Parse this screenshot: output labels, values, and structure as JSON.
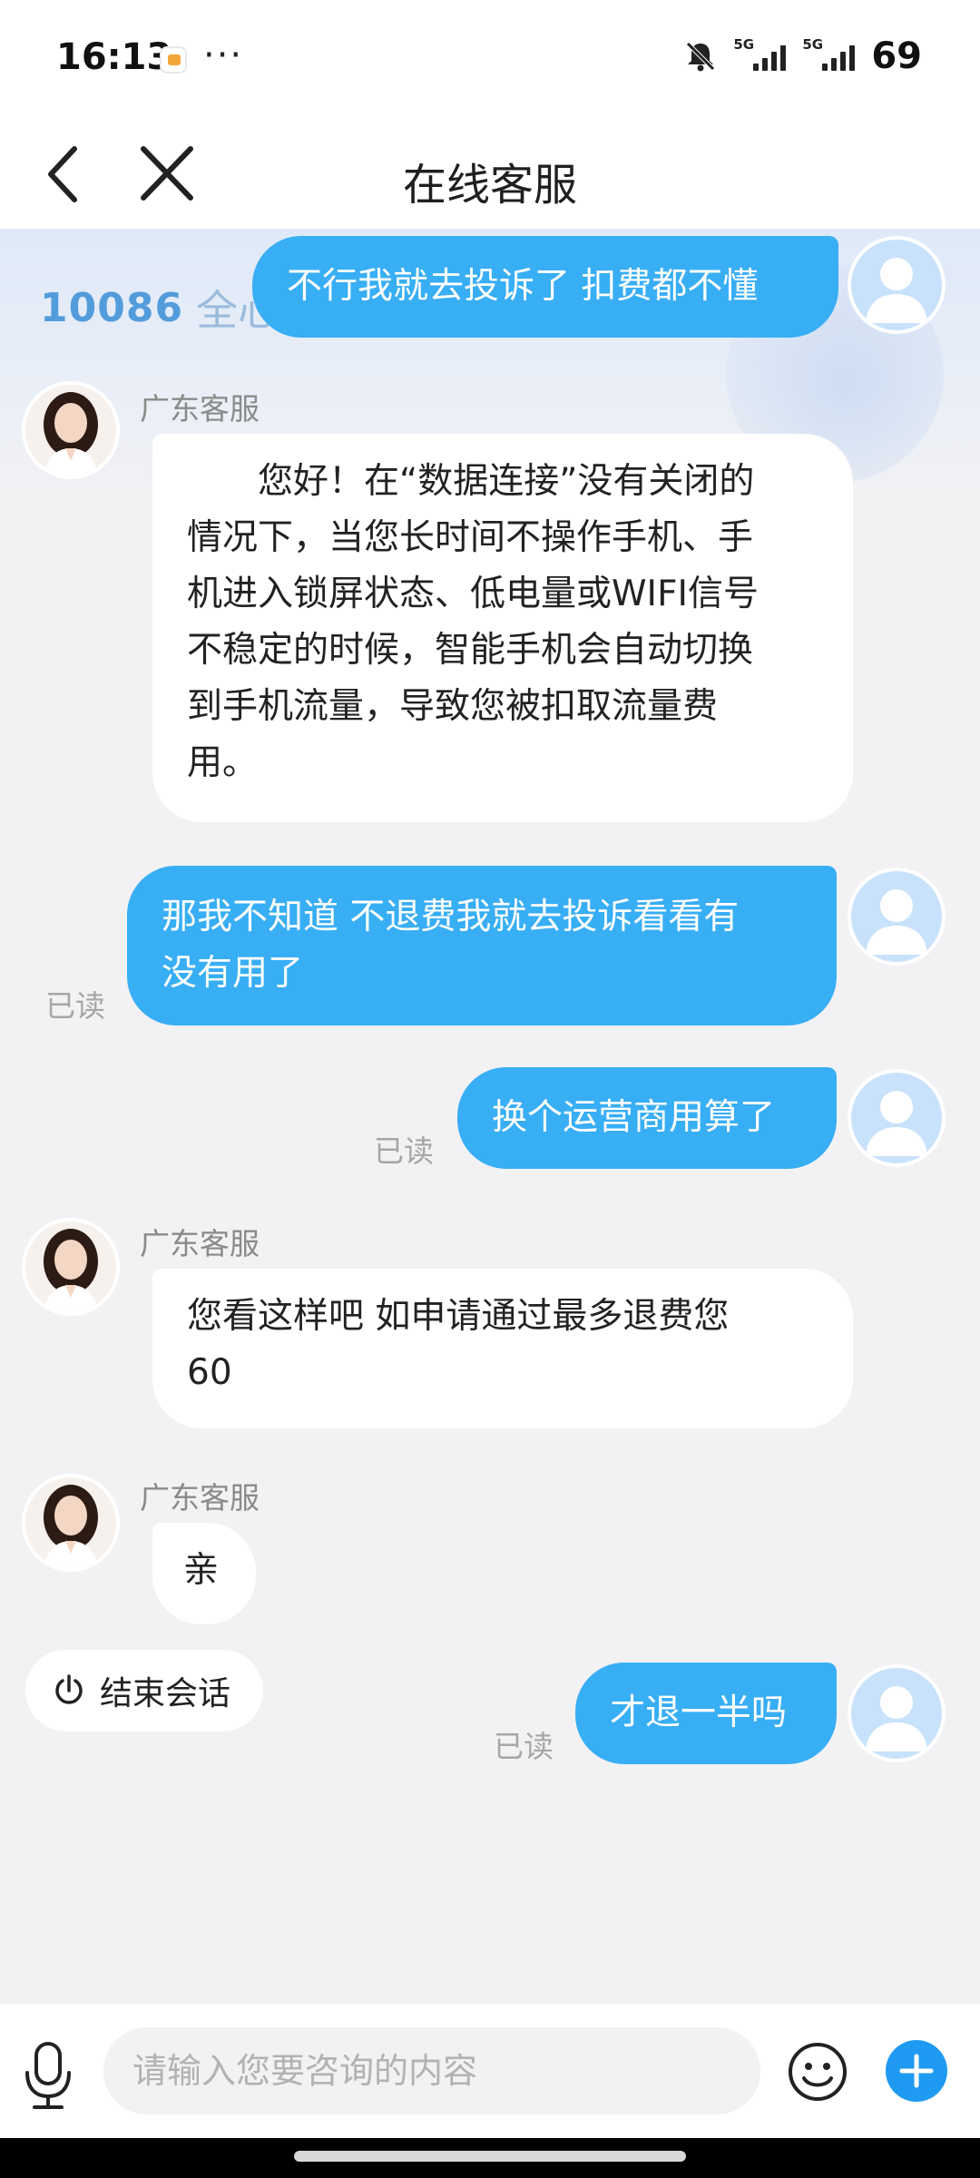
{
  "status_bar": {
    "time": "16:13",
    "more": "···",
    "network_1": "5G",
    "network_2": "5G",
    "battery": "69"
  },
  "header": {
    "title": "在线客服"
  },
  "brand": {
    "number": "10086",
    "text": "全心全"
  },
  "messages": [
    {
      "role": "user",
      "text": "不行我就去投诉了 扣费都不懂"
    },
    {
      "role": "agent",
      "name": "广东客服",
      "lines": [
        "　　您好！在“数据连接”没有关闭的",
        "情况下，当您长时间不操作手机、手",
        "机进入锁屏状态、低电量或WIFI信号",
        "不稳定的时候，智能手机会自动切换",
        "到手机流量，导致您被扣取流量费",
        "用。"
      ]
    },
    {
      "role": "user",
      "lines": [
        "那我不知道 不退费我就去投诉看看有",
        "没有用了"
      ],
      "read": "已读"
    },
    {
      "role": "user",
      "text": "换个运营商用算了",
      "read": "已读"
    },
    {
      "role": "agent",
      "name": "广东客服",
      "lines": [
        "您看这样吧 如申请通过最多退费您",
        "60"
      ]
    },
    {
      "role": "agent",
      "name": "广东客服",
      "text": "亲"
    },
    {
      "role": "user",
      "text": "才退一半吗",
      "read": "已读"
    }
  ],
  "end_session_label": "结束会话",
  "input": {
    "placeholder": "请输入您要咨询的内容"
  },
  "colors": {
    "user_bubble": "#38aef5",
    "send_plus": "#1e9af2",
    "background": "#f2f2f4"
  },
  "icons": [
    "back-arrow-icon",
    "close-icon",
    "mute-icon",
    "signal-icon",
    "power-icon",
    "microphone-icon",
    "emoji-icon",
    "plus-icon"
  ]
}
